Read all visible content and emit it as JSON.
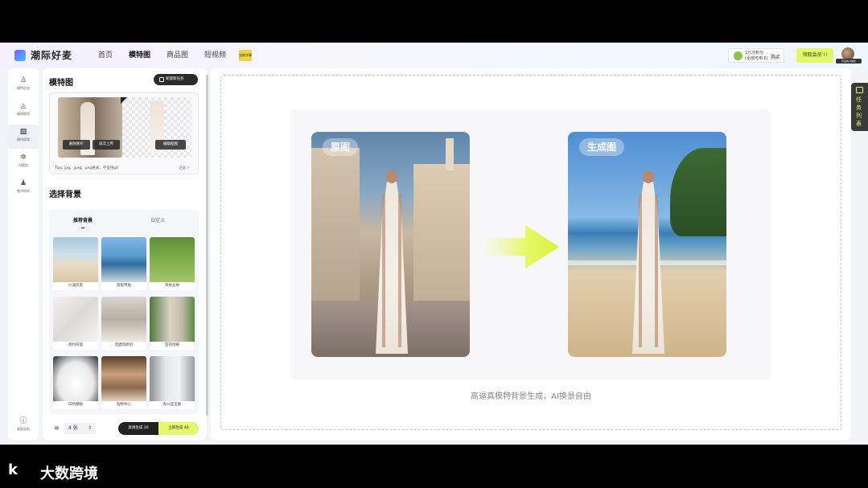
{
  "header": {
    "brand": "潮际好麦",
    "nav": [
      {
        "label": "首页",
        "active": false
      },
      {
        "label": "模特图",
        "active": true
      },
      {
        "label": "商品图",
        "active": false
      },
      {
        "label": "短视频",
        "active": false
      }
    ],
    "nav_badge": "起做字幕",
    "points_line1": "1万次积分",
    "points_line2": "(全部可用 6)",
    "recharge": "购买",
    "upgrade": "领取会员 !!",
    "avatar_label": "可爱的小朋友"
  },
  "rail": {
    "items": [
      {
        "label": "模特试衣",
        "icon": "hanger-icon",
        "glyph": "♙",
        "active": false
      },
      {
        "label": "服饰换色",
        "icon": "palette-icon",
        "glyph": "◬",
        "active": false
      },
      {
        "label": "模特换背",
        "icon": "image-icon",
        "glyph": "▨",
        "active": true
      },
      {
        "label": "AI换脸",
        "icon": "face-icon",
        "glyph": "✲",
        "active": false
      },
      {
        "label": "细节修补",
        "icon": "people-icon",
        "glyph": "♟",
        "active": false
      }
    ],
    "bottom_label": "收起导航",
    "bottom_icon": "info-icon",
    "bottom_glyph": "ⓘ"
  },
  "panel": {
    "title": "模特图",
    "new_task": "新建新任务",
    "btn_reupload": "删除图片",
    "btn_again": "再次上传",
    "btn_edit": "编辑抠图",
    "hint": "Tips: jpg、jpeg、png格式，不支持gif",
    "record": "记录 >",
    "bg_title": "选择背景",
    "tab_recommended": "推荐背景",
    "tab_custom": "自定义",
    "backgrounds": [
      {
        "label": "沙滩风景"
      },
      {
        "label": "游艇甲板"
      },
      {
        "label": "草地丛林"
      },
      {
        "label": "简约白墙"
      },
      {
        "label": "北欧风厨房"
      },
      {
        "label": "室内绿植"
      },
      {
        "label": "白色棚拍"
      },
      {
        "label": "购物中心"
      },
      {
        "label": "办公室走廊"
      }
    ],
    "count": "4 张",
    "gen_hq": "高清生成 20",
    "gen_fast": "立即生成 40"
  },
  "main": {
    "tag_orig": "原图",
    "tag_gen": "生成图",
    "caption": "高逼真模特背景生成，AI换景自由"
  },
  "task_tab": "任务列表",
  "watermark": {
    "mark": "k",
    "text": "大数跨境"
  },
  "colors": {
    "accent": "#e2f86a",
    "dark": "#222222"
  }
}
